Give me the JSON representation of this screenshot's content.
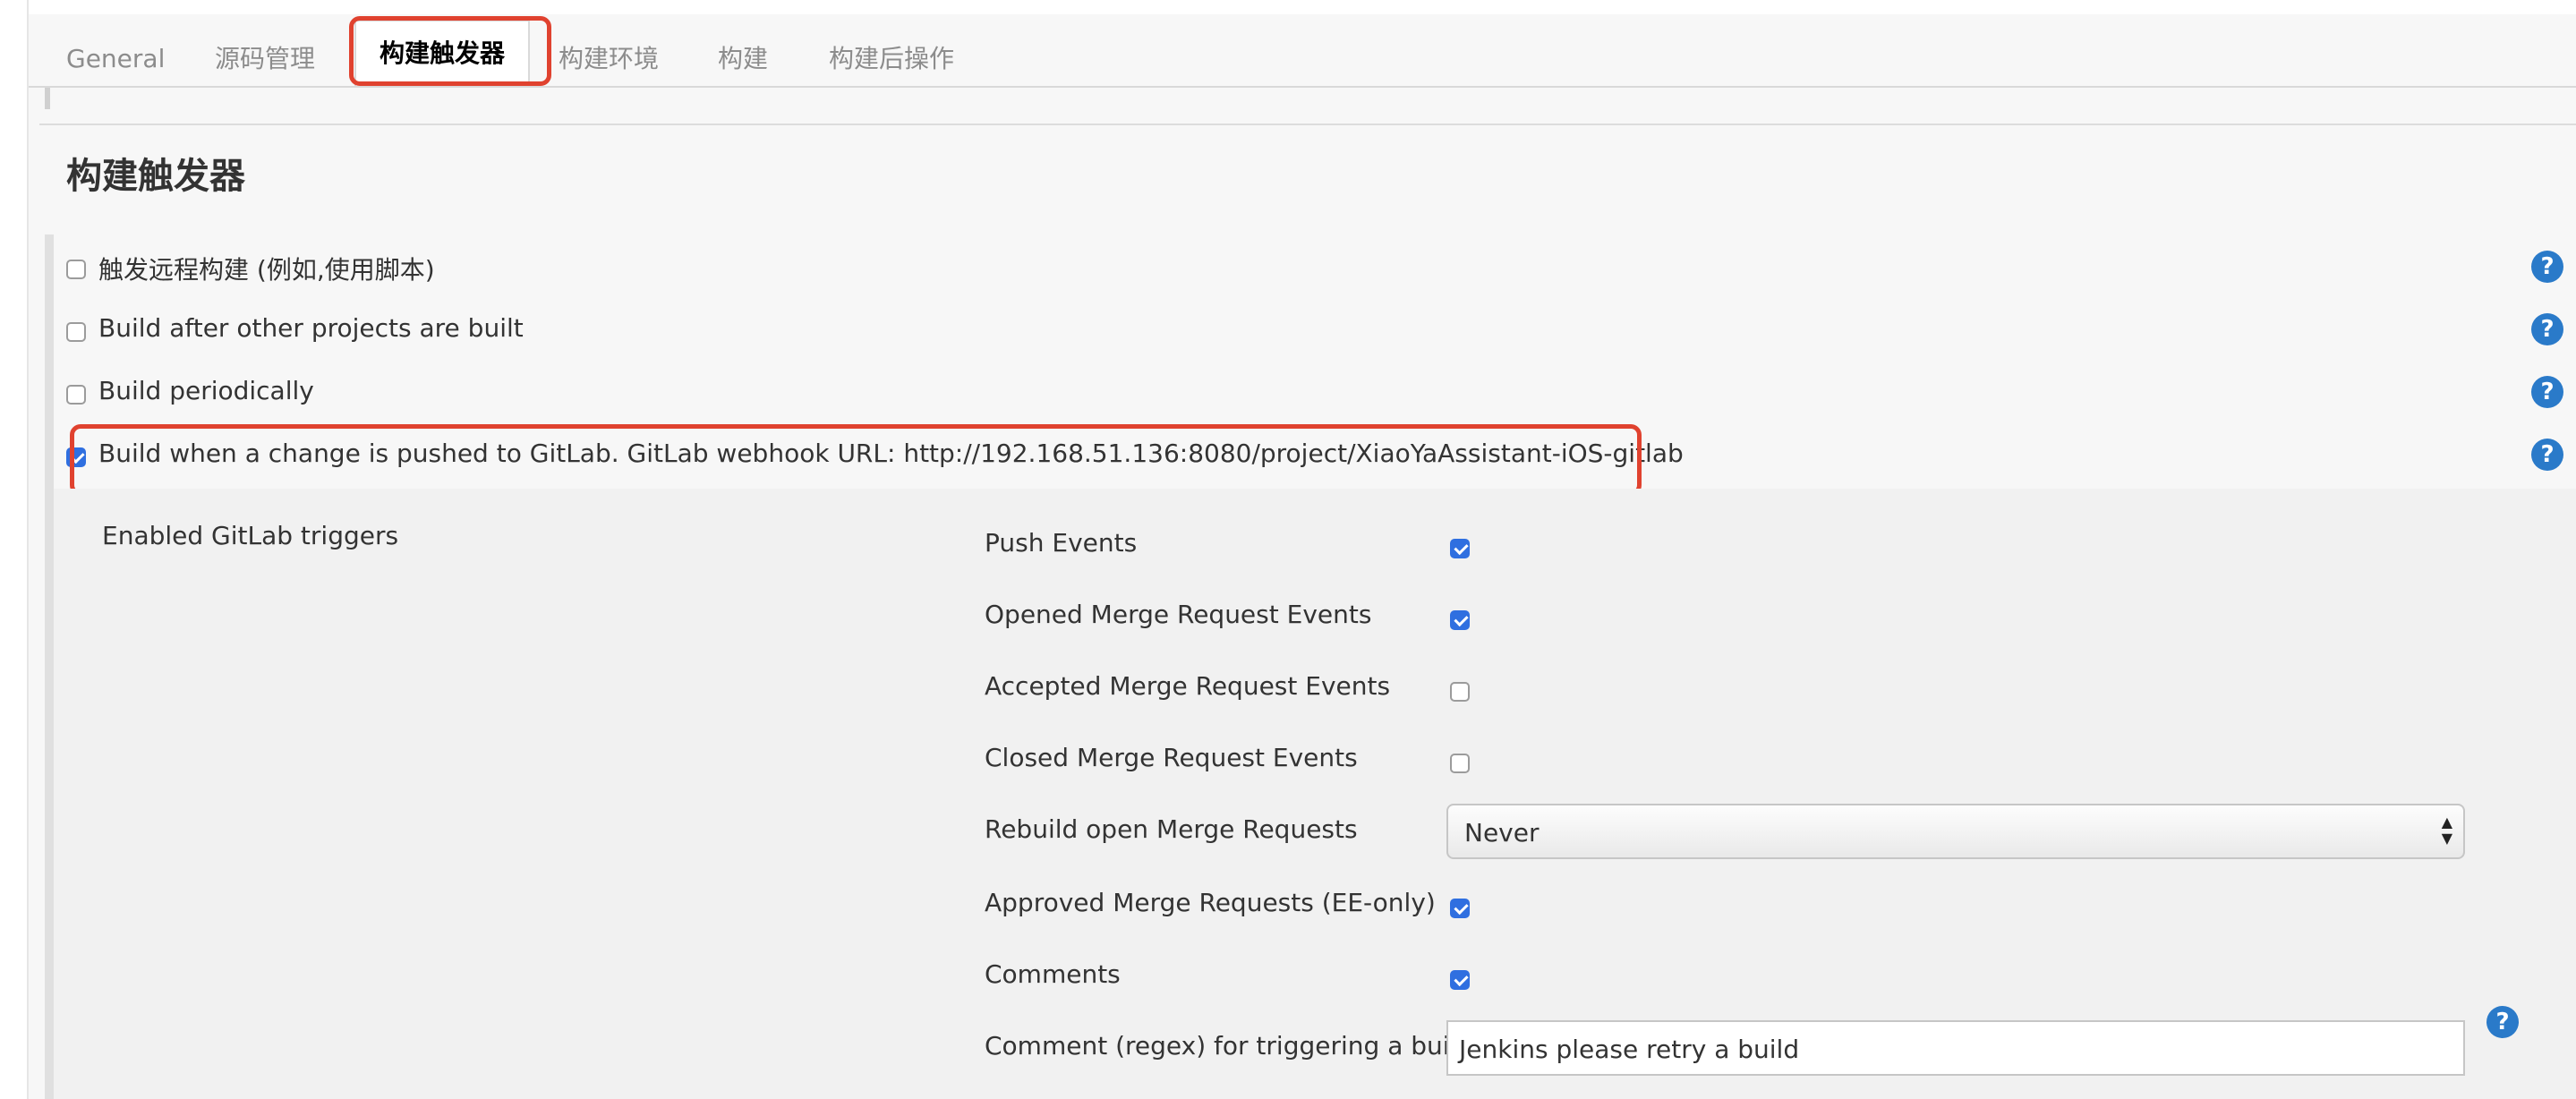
{
  "tabs": [
    {
      "label": "General"
    },
    {
      "label": "源码管理"
    },
    {
      "label": "构建触发器",
      "active": true
    },
    {
      "label": "构建环境"
    },
    {
      "label": "构建"
    },
    {
      "label": "构建后操作"
    }
  ],
  "section": {
    "title": "构建触发器"
  },
  "triggers": [
    {
      "label": "触发远程构建 (例如,使用脚本)",
      "checked": false
    },
    {
      "label": "Build after other projects are built",
      "checked": false
    },
    {
      "label": "Build periodically",
      "checked": false
    },
    {
      "label": "Build when a change is pushed to GitLab. GitLab webhook URL: http://192.168.51.136:8080/project/XiaoYaAssistant-iOS-gitlab",
      "checked": true
    }
  ],
  "gitlab": {
    "enabled_label": "Enabled GitLab triggers",
    "options": [
      {
        "label": "Push Events",
        "checked": true
      },
      {
        "label": "Opened Merge Request Events",
        "checked": true
      },
      {
        "label": "Accepted Merge Request Events",
        "checked": false
      },
      {
        "label": "Closed Merge Request Events",
        "checked": false
      },
      {
        "label": "Rebuild open Merge Requests",
        "value": "Never"
      },
      {
        "label": "Approved Merge Requests (EE-only)",
        "checked": true
      },
      {
        "label": "Comments",
        "checked": true
      },
      {
        "label": "Comment (regex) for triggering a build",
        "value": "Jenkins please retry a build"
      }
    ]
  },
  "help_glyph": "?",
  "colors": {
    "highlight": "#e0422f",
    "checkbox": "#2f6fe0",
    "help": "#2a7ac9"
  }
}
